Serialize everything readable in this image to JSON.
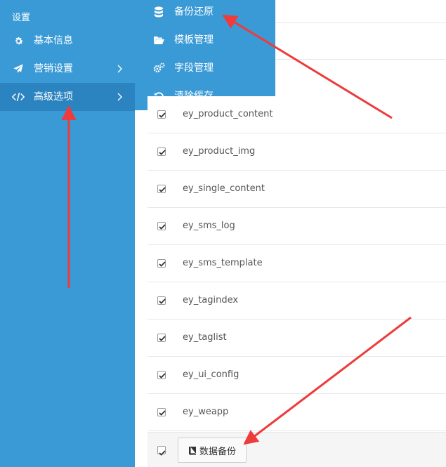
{
  "sidebar": {
    "section_title": "设置",
    "items": [
      {
        "label": "基本信息",
        "icon": "gear-icon"
      },
      {
        "label": "营销设置",
        "icon": "paper-plane-icon"
      },
      {
        "label": "高级选项",
        "icon": "code-icon"
      }
    ]
  },
  "flyout": {
    "items": [
      {
        "label": "备份还原",
        "icon": "database-icon"
      },
      {
        "label": "模板管理",
        "icon": "folder-open-icon"
      },
      {
        "label": "字段管理",
        "icon": "gears-icon"
      },
      {
        "label": "清除缓存",
        "icon": "refresh-icon"
      }
    ]
  },
  "tables": {
    "rows": [
      {
        "name": "ey_product_content",
        "checked": true
      },
      {
        "name": "ey_product_img",
        "checked": true
      },
      {
        "name": "ey_single_content",
        "checked": true
      },
      {
        "name": "ey_sms_log",
        "checked": true
      },
      {
        "name": "ey_sms_template",
        "checked": true
      },
      {
        "name": "ey_tagindex",
        "checked": true
      },
      {
        "name": "ey_taglist",
        "checked": true
      },
      {
        "name": "ey_ui_config",
        "checked": true
      },
      {
        "name": "ey_weapp",
        "checked": true
      }
    ]
  },
  "footer": {
    "backup_label": "数据备份",
    "backup_icon": "book-icon"
  },
  "colors": {
    "sidebar_bg": "#3a9ad6",
    "active_bg": "#2b84c0",
    "arrow": "#ee3b3b"
  }
}
